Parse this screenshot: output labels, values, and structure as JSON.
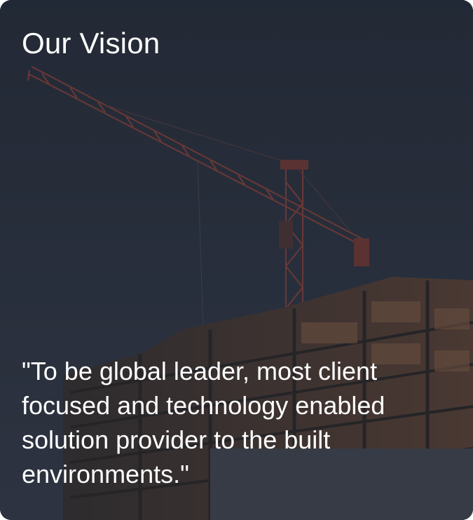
{
  "card": {
    "title": "Our Vision",
    "quote": "\"To be global leader, most client focused and technology enabled solution provider to the built environments.\"",
    "background_image": "crane-over-building-under-construction-photo"
  },
  "colors": {
    "sky_top": "#27303d",
    "sky_bottom": "#3a4250",
    "crane": "#b04a3c",
    "building": "#3b342f",
    "building_light": "#8a5a3a",
    "text": "#ffffff"
  }
}
